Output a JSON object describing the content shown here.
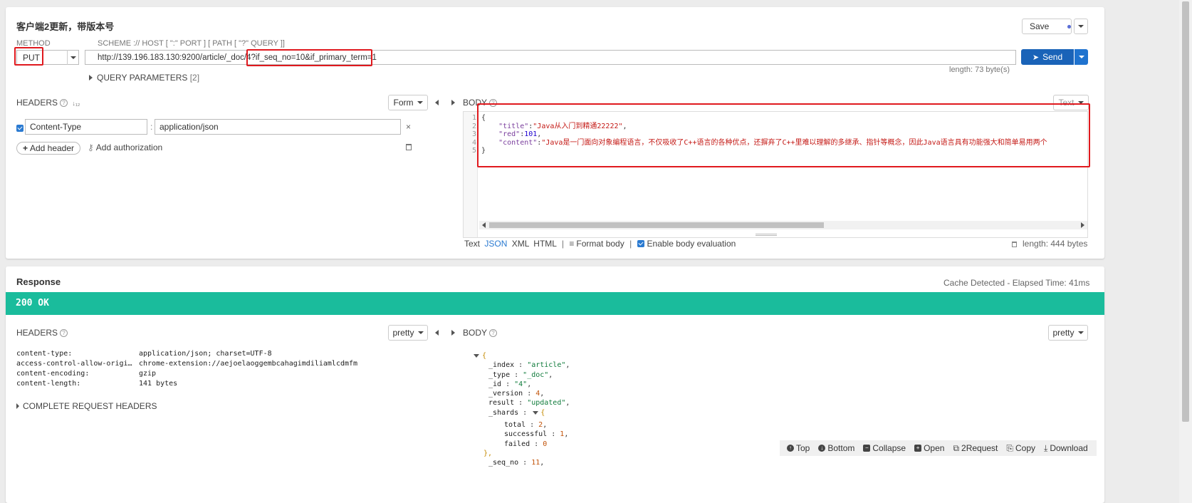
{
  "request": {
    "title": "客户端2更新，带版本号",
    "save_label": "Save",
    "method_label": "METHOD",
    "scheme_label": "SCHEME :// HOST [ \":\" PORT ] [ PATH [ \"?\" QUERY ]]",
    "method": "PUT",
    "url": "http://139.196.183.130:9200/article/_doc/4?if_seq_no=10&if_primary_term=1",
    "send_label": "Send",
    "url_length": "length: 73 byte(s)",
    "query_params_label": "QUERY PARAMETERS",
    "query_params_count": "[2]",
    "headers_label": "HEADERS",
    "headers_mode": "Form",
    "header_name": "Content-Type",
    "header_value": "application/json",
    "header_sep": ":",
    "add_header_label": "Add header",
    "add_auth_label": "Add authorization",
    "body_label": "BODY",
    "body_mode": "Text",
    "body_lines": {
      "l1": "{",
      "l2_key": "\"title\"",
      "l2_val": "\"Java从入门到精通22222\"",
      "l3_key": "\"red\"",
      "l3_val": "101",
      "l4_key": "\"content\"",
      "l4_val": "\"Java是一门面向对象编程语言，不仅吸收了C++语言的各种优点，还摒弃了C++里难以理解的多继承、指针等概念，因此Java语言具有功能强大和简单易用两个",
      "l5": "}"
    },
    "body_formats": {
      "text": "Text",
      "json": "JSON",
      "xml": "XML",
      "html": "HTML",
      "sep": "|",
      "format_body": "Format body",
      "enable_eval": "Enable body evaluation"
    },
    "body_length": "length: 444 bytes"
  },
  "response": {
    "title": "Response",
    "cache_info": "Cache Detected - Elapsed Time: 41ms",
    "status": "200 OK",
    "status_color": "#1abc9c",
    "headers_label": "HEADERS",
    "headers_mode": "pretty",
    "headers": [
      {
        "name": "content-type:",
        "value": "application/json; charset=UTF-8"
      },
      {
        "name": "access-control-allow-origi…",
        "value": "chrome-extension://aejoelaoggembcahagimdiliamlcdmfm"
      },
      {
        "name": "content-encoding:",
        "value": "gzip"
      },
      {
        "name": "content-length:",
        "value": "141 bytes"
      }
    ],
    "complete_headers_label": "COMPLETE REQUEST HEADERS",
    "body_label": "BODY",
    "body_mode": "pretty",
    "json": {
      "open": "{",
      "index_k": "_index",
      "index_v": "\"article\"",
      "type_k": "_type",
      "type_v": "\"_doc\"",
      "id_k": "_id",
      "id_v": "\"4\"",
      "version_k": "_version",
      "version_v": "4",
      "result_k": "result",
      "result_v": "\"updated\"",
      "shards_k": "_shards",
      "total_k": "total",
      "total_v": "2",
      "successful_k": "successful",
      "successful_v": "1",
      "failed_k": "failed",
      "failed_v": "0",
      "close_inner": "},",
      "seqno_k": "_seq_no",
      "seqno_v": "11"
    },
    "toolbar": {
      "top": "Top",
      "bottom": "Bottom",
      "collapse": "Collapse",
      "open": "Open",
      "to_request": "2Request",
      "copy": "Copy",
      "download": "Download"
    }
  },
  "colors": {
    "send": "#1a63b8",
    "annotation": "#e0191e"
  }
}
